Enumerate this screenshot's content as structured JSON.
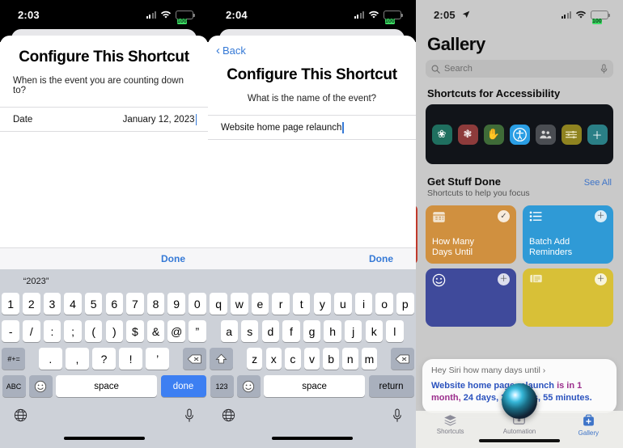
{
  "panels": [
    {
      "id": "panel-configure-date",
      "status": {
        "time": "2:03",
        "battery": "100",
        "cellular": "cellular-icon",
        "wifi": "wifi-icon"
      },
      "sheet": {
        "title": "Configure This Shortcut",
        "subtitle": "When is the event you are counting down to?",
        "field_label": "Date",
        "field_value": "January  12, 2023"
      },
      "accessory": {
        "done_label": "Done"
      },
      "keyboard": {
        "type": "numeric-symbols",
        "prediction": [
          "“2023”",
          "",
          ""
        ],
        "row1": [
          "1",
          "2",
          "3",
          "4",
          "5",
          "6",
          "7",
          "8",
          "9",
          "0"
        ],
        "row2": [
          "-",
          "/",
          ":",
          ";",
          "(",
          ")",
          "$",
          "&",
          "@",
          "”"
        ],
        "row3_left": "#+=",
        "row3": [
          ".",
          ",",
          "?",
          "!",
          "’"
        ],
        "row3_right": "delete-icon",
        "row4_left": "ABC",
        "emoji": "emoji-icon",
        "space_label": "space",
        "action_label": "done",
        "globe": "globe-icon",
        "mic": "microphone-icon"
      }
    },
    {
      "id": "panel-configure-name",
      "status": {
        "time": "2:04",
        "battery": "100",
        "cellular": "cellular-icon",
        "wifi": "wifi-icon"
      },
      "sheet": {
        "back_label": "Back",
        "title": "Configure This Shortcut",
        "subtitle": "What is the name of the event?",
        "field_value": "Website home page relaunch"
      },
      "accessory": {
        "done_label": "Done"
      },
      "keyboard": {
        "type": "alphabetic",
        "prediction": [
          "",
          "",
          ""
        ],
        "row1": [
          "q",
          "w",
          "e",
          "r",
          "t",
          "y",
          "u",
          "i",
          "o",
          "p"
        ],
        "row2": [
          "a",
          "s",
          "d",
          "f",
          "g",
          "h",
          "j",
          "k",
          "l"
        ],
        "row3_left": "shift-icon",
        "row3": [
          "z",
          "x",
          "c",
          "v",
          "b",
          "n",
          "m"
        ],
        "row3_right": "delete-icon",
        "row4_left": "123",
        "emoji": "emoji-icon",
        "space_label": "space",
        "action_label": "return",
        "globe": "globe-icon",
        "mic": "microphone-icon"
      }
    }
  ],
  "gallery": {
    "status": {
      "time": "2:05",
      "location": "location-arrow-icon",
      "battery": "100"
    },
    "title": "Gallery",
    "search": {
      "placeholder": "Search",
      "icon": "search-icon",
      "mic": "microphone-icon"
    },
    "sections": [
      {
        "heading": "Shortcuts for Accessibility",
        "banner_icons": [
          {
            "name": "leaf-icon",
            "glyph": "❀",
            "color": "#1f6f5f"
          },
          {
            "name": "asterisk-icon",
            "glyph": "✳",
            "color": "#8d3b3b"
          },
          {
            "name": "hand-icon",
            "glyph": "✋",
            "color": "#3f6b38"
          },
          {
            "name": "accessibility-icon",
            "glyph": "Ⓙ",
            "color": "#2a9ee4"
          },
          {
            "name": "people-icon",
            "glyph": "👥",
            "color": "#4a4d52"
          },
          {
            "name": "sliders-icon",
            "glyph": "≡",
            "color": "#8f8320"
          },
          {
            "name": "plus-icon",
            "glyph": "＋",
            "color": "#2a7f86"
          }
        ]
      },
      {
        "heading": "Get Stuff Done",
        "see_all": "See All",
        "subtitle": "Shortcuts to help you focus",
        "cards": [
          {
            "label": "How Many\nDays Until",
            "color": "#d0903f",
            "icon": "calendar-icon",
            "badge": "check-badge",
            "badge_glyph": "✓"
          },
          {
            "label": "Batch Add\nReminders",
            "color": "#2f9ad6",
            "icon": "list-icon",
            "badge": "add-badge",
            "badge_glyph": "＋"
          }
        ],
        "cards_row2": [
          {
            "label": "",
            "color": "#3f4a9b",
            "icon": "smiley-icon",
            "badge_glyph": "＋"
          },
          {
            "label": "",
            "color": "#d8c037",
            "icon": "ticket-icon",
            "badge_glyph": "＋"
          }
        ]
      }
    ],
    "siri": {
      "query": "Hey Siri how many days until",
      "chevron": "chevron-right-icon",
      "answer_part1": "Website home page relaunch ",
      "answer_accent": "is in 1 month,",
      "answer_part2": " 24 days, 21 hours, 55 minutes."
    },
    "tabbar": [
      {
        "label": "Shortcuts",
        "icon": "stack-icon",
        "active": false
      },
      {
        "label": "Automation",
        "icon": "automation-icon",
        "active": false
      },
      {
        "label": "Gallery",
        "icon": "gallery-icon",
        "active": true
      }
    ],
    "siri_orb": "siri-orb"
  }
}
